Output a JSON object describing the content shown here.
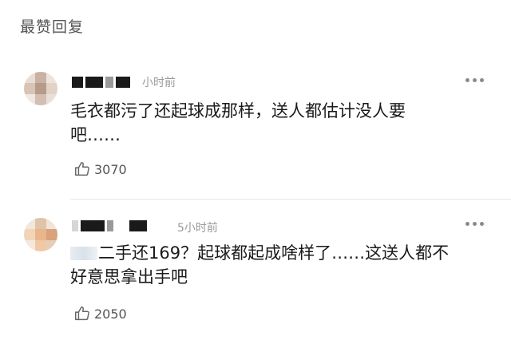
{
  "section": {
    "title": "最赞回复"
  },
  "comments": [
    {
      "time": "小时前",
      "text_line1": "毛衣都污了还起球成那样，送人都估计没人要",
      "text_line2": "吧……",
      "likes": "3070",
      "more_icon": "more-dots-icon",
      "like_icon": "thumbs-up-icon"
    },
    {
      "time": "5小时前",
      "text_line1": "二手还169？起球都起成啥样了……这送人都不",
      "text_line2": "好意思拿出手吧",
      "likes": "2050",
      "more_icon": "more-dots-icon",
      "like_icon": "thumbs-up-icon"
    }
  ]
}
